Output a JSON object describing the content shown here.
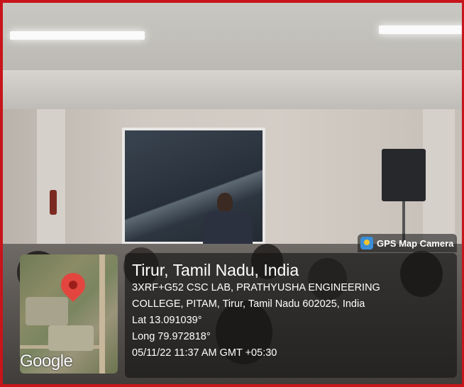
{
  "overlay": {
    "app_name": "GPS Map Camera",
    "place": "Tirur, Tamil Nadu, India",
    "address_line1": "3XRF+G52 CSC LAB, PRATHYUSHA ENGINEERING",
    "address_line2": "COLLEGE, PITAM, Tirur, Tamil Nadu 602025, India",
    "latitude": "Lat 13.091039°",
    "longitude": "Long 79.972818°",
    "datetime": "05/11/22 11:37 AM GMT +05:30",
    "map_brand": "Google"
  },
  "colors": {
    "frame_border": "#c8141b",
    "pin": "#e2463f"
  },
  "icons": {
    "badge": "gps-map-camera-icon",
    "map_pin": "map-pin-icon"
  }
}
